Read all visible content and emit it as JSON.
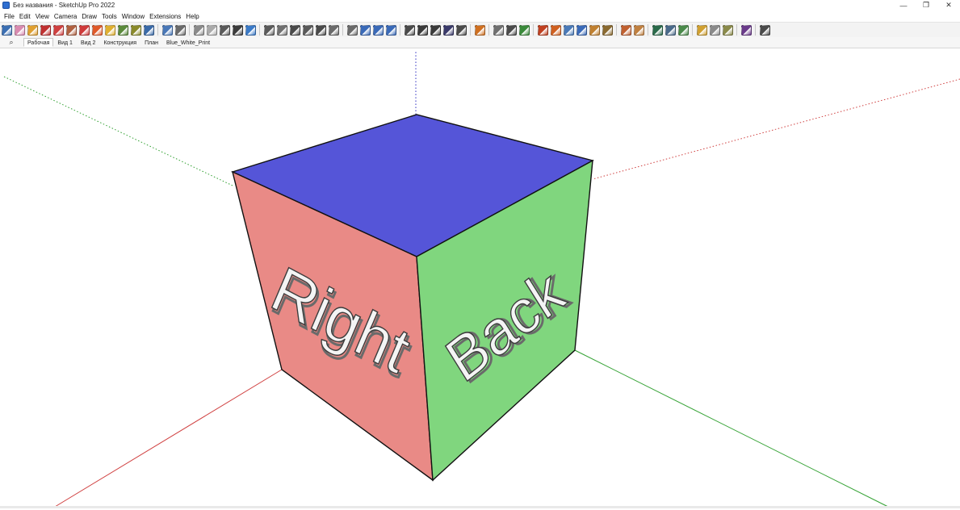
{
  "window": {
    "title": "Без названия - SketchUp Pro 2022",
    "controls": {
      "minimize": "—",
      "maximize": "❐",
      "close": "✕"
    }
  },
  "menu": {
    "items": [
      "File",
      "Edit",
      "View",
      "Camera",
      "Draw",
      "Tools",
      "Window",
      "Extensions",
      "Help"
    ]
  },
  "toolbar": {
    "buttons": [
      {
        "icon": "get-started-icon",
        "color": "#3b6fb3"
      },
      {
        "icon": "eraser-icon",
        "color": "#d98ab0"
      },
      {
        "icon": "pencil-icon",
        "color": "#e0a030"
      },
      {
        "icon": "line-icon",
        "color": "#c03030"
      },
      {
        "icon": "arc-icon",
        "color": "#d04040"
      },
      {
        "icon": "push-pull-icon",
        "color": "#b06040"
      },
      {
        "icon": "rectangle-icon",
        "color": "#cf3a3a"
      },
      {
        "icon": "paint-bucket-icon",
        "color": "#e05a2a"
      },
      {
        "icon": "offset-icon",
        "color": "#e0b030"
      },
      {
        "icon": "move-icon",
        "color": "#5a8a3a"
      },
      {
        "icon": "tape-measure-icon",
        "color": "#8a8a2a"
      },
      {
        "icon": "zoom-icon",
        "color": "#3a6aa8"
      },
      {
        "sep": true
      },
      {
        "icon": "x-ray-icon",
        "color": "#4a78b8"
      },
      {
        "icon": "back-edges-icon",
        "color": "#6a6a6a"
      },
      {
        "sep": true
      },
      {
        "icon": "wireframe-icon",
        "color": "#8a8a8a"
      },
      {
        "icon": "hidden-line-icon",
        "color": "#aaaaaa"
      },
      {
        "icon": "shaded-icon",
        "color": "#5a5a5a"
      },
      {
        "icon": "shaded-texture-icon",
        "color": "#3c3c3c"
      },
      {
        "icon": "monochrome-icon",
        "color": "#3a7ac8"
      },
      {
        "sep": true
      },
      {
        "icon": "iso-view-icon",
        "color": "#5a5a5a"
      },
      {
        "icon": "top-view-icon",
        "color": "#707070"
      },
      {
        "icon": "front-view-icon",
        "color": "#4a4a4a"
      },
      {
        "icon": "right-view-icon",
        "color": "#5a5a5a"
      },
      {
        "icon": "back-view-icon",
        "color": "#4a4a4a"
      },
      {
        "icon": "left-view-icon",
        "color": "#6a6a6a"
      },
      {
        "sep": true
      },
      {
        "icon": "orbit-icon",
        "color": "#6a6a6a"
      },
      {
        "icon": "pan-icon",
        "color": "#3a6ab8"
      },
      {
        "icon": "zoom-window-icon",
        "color": "#3a6ab8"
      },
      {
        "icon": "zoom-extents-icon",
        "color": "#3a6ab8"
      },
      {
        "sep": true
      },
      {
        "icon": "solid-union-icon",
        "color": "#4a4a4a"
      },
      {
        "icon": "solid-subtract-icon",
        "color": "#3a3a3a"
      },
      {
        "icon": "solid-trim-icon",
        "color": "#3a3a3a"
      },
      {
        "icon": "solid-split-icon",
        "color": "#3a3a6a"
      },
      {
        "icon": "outer-shell-icon",
        "color": "#4a4a4a"
      },
      {
        "sep": true
      },
      {
        "icon": "section-plane-icon",
        "color": "#d07020"
      },
      {
        "sep": true
      },
      {
        "icon": "axes-icon",
        "color": "#707070"
      },
      {
        "icon": "dimension-icon",
        "color": "#4a4a4a"
      },
      {
        "icon": "protractor-icon",
        "color": "#3a8a3a"
      },
      {
        "sep": true
      },
      {
        "icon": "sandbox-icon",
        "color": "#c04020"
      },
      {
        "icon": "smoove-icon",
        "color": "#d06020"
      },
      {
        "icon": "stamp-icon",
        "color": "#4a7ab8"
      },
      {
        "icon": "drape-icon",
        "color": "#3a6ab8"
      },
      {
        "icon": "add-detail-icon",
        "color": "#c08030"
      },
      {
        "icon": "flip-edge-icon",
        "color": "#8a6a30"
      },
      {
        "sep": true
      },
      {
        "icon": "photo-match-icon",
        "color": "#c06030"
      },
      {
        "icon": "photo-texture-icon",
        "color": "#c08040"
      },
      {
        "sep": true
      },
      {
        "icon": "geo-location-icon",
        "color": "#2a6a4a"
      },
      {
        "icon": "model-info-icon",
        "color": "#4a6a8a"
      },
      {
        "icon": "tag-icon",
        "color": "#4a8a4a"
      },
      {
        "sep": true
      },
      {
        "icon": "warehouse-icon",
        "color": "#d0a030"
      },
      {
        "icon": "share-component-icon",
        "color": "#8a8a8a"
      },
      {
        "icon": "extension-warehouse-icon",
        "color": "#8a8a4a"
      },
      {
        "sep": true
      },
      {
        "icon": "ruby-console-icon",
        "color": "#6a3a8a"
      },
      {
        "sep": true
      },
      {
        "icon": "line-tool-icon",
        "color": "#4a4a4a"
      }
    ]
  },
  "scenes": {
    "search_icon": "⌕",
    "tabs": [
      "Рабочая",
      "Вид 1",
      "Вид 2",
      "Конструкция",
      "План",
      "Blue_White_Print"
    ],
    "active": 0
  },
  "model": {
    "faces": {
      "top": {
        "color": "#5555d8"
      },
      "right": {
        "color": "#e98a86"
      },
      "back": {
        "color": "#80d67e"
      }
    },
    "labels": {
      "right_face": "Right",
      "back_face": "Back"
    },
    "axes_colors": {
      "red": "#d04040",
      "green": "#30a030",
      "blue": "#3030c0"
    }
  }
}
